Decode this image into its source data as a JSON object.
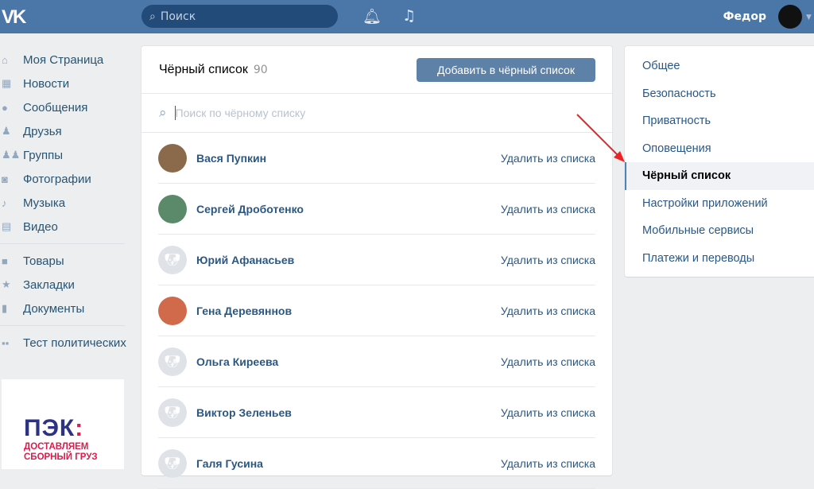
{
  "header": {
    "logo": "VK",
    "search_placeholder": "Поиск",
    "user_name": "Федор"
  },
  "sidebar": {
    "items": [
      {
        "label": "Моя Страница",
        "icon": "home-icon"
      },
      {
        "label": "Новости",
        "icon": "news-icon"
      },
      {
        "label": "Сообщения",
        "icon": "messages-icon"
      },
      {
        "label": "Друзья",
        "icon": "friends-icon"
      },
      {
        "label": "Группы",
        "icon": "groups-icon"
      },
      {
        "label": "Фотографии",
        "icon": "camera-icon"
      },
      {
        "label": "Музыка",
        "icon": "music-icon"
      },
      {
        "label": "Видео",
        "icon": "video-icon"
      },
      {
        "label": "Товары",
        "icon": "bag-icon"
      },
      {
        "label": "Закладки",
        "icon": "star-icon"
      },
      {
        "label": "Документы",
        "icon": "document-icon"
      },
      {
        "label": "Тест политических",
        "icon": "app-icon"
      }
    ]
  },
  "ad": {
    "brand": "ПЭК",
    "line1": "ДОСТАВЛЯЕМ",
    "line2": "СБОРНЫЙ ГРУЗ"
  },
  "main": {
    "title": "Чёрный список",
    "count": "90",
    "add_button": "Добавить в чёрный список",
    "search_placeholder": "Поиск по чёрному списку",
    "remove_label": "Удалить из списка",
    "users": [
      "Вася Пупкин",
      "Сергей Дроботенко",
      "Юрий Афанасьев",
      "Гена Деревяннов",
      "Ольга Киреева",
      "Виктор Зеленьев",
      "Галя Гусина"
    ]
  },
  "settings": {
    "items": [
      "Общее",
      "Безопасность",
      "Приватность",
      "Оповещения",
      "Чёрный список",
      "Настройки приложений",
      "Мобильные сервисы",
      "Платежи и переводы"
    ],
    "active": "Чёрный список"
  }
}
